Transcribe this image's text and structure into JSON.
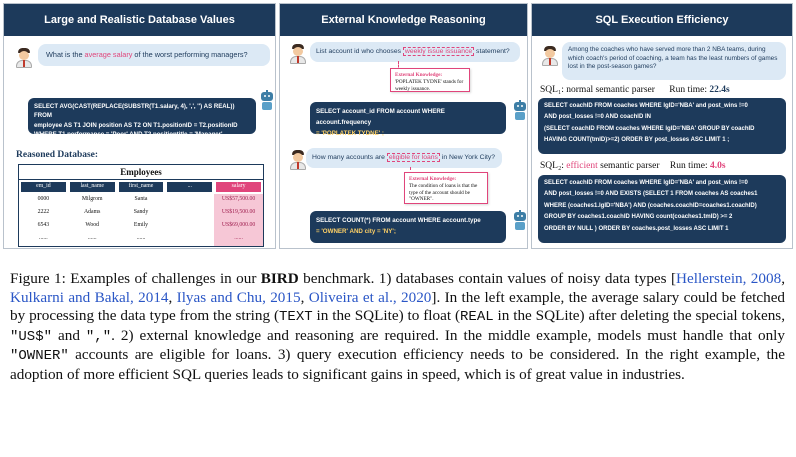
{
  "panel1": {
    "title": "Large and Realistic Database Values",
    "question_pre": "What is the ",
    "question_hl": "average salary",
    "question_post": " of the worst performing managers?",
    "sql_lines": [
      "SELECT AVG(CAST(REPLACE(SUBSTR(T1.salary, 4), ',', '') AS REAL)) FROM",
      "employee AS T1 JOIN position AS T2 ON T1.positionID = T2.positionID",
      "WHERE T1.performance = 'Poor' AND T2.positiontitle = 'Manager'"
    ],
    "db_label": "Reasoned Database:",
    "table_name": "Employees",
    "columns": [
      "em_id",
      "last_name",
      "first_name",
      "...",
      "salary"
    ],
    "rows": [
      [
        "0000",
        "Milgrom",
        "Santa",
        "",
        "US$57,500.00"
      ],
      [
        "2222",
        "Adams",
        "Sandy",
        "",
        "US$19,500.00"
      ],
      [
        "6543",
        "Wood",
        "Emily",
        "",
        "US$69,000.00"
      ],
      [
        "......",
        "......",
        "......",
        "",
        "......"
      ]
    ]
  },
  "panel2": {
    "title": "External Knowledge Reasoning",
    "q1_pre": "List account id who chooses ",
    "q1_hl": "weekly issue issuance",
    "q1_post": " statement?",
    "k1_title": "External Knowledge:",
    "k1_text": "'POPLATEK TYDNE' stands for weekly issuance.",
    "sql1_a": "SELECT account_id FROM account WHERE account.frequency",
    "sql1_b": "= 'POPLATEK TYDNE' ;",
    "q2_pre": "How many accounts are ",
    "q2_hl": "eligible for loans",
    "q2_post": " in New York City?",
    "k2_title": "External Knowledge:",
    "k2_text": "The condition of loans is that the type of the account should be \"OWNER\".",
    "sql2_a": "SELECT COUNT(*) FROM account WHERE account.type",
    "sql2_b": "= 'OWNER' AND city = 'NY';"
  },
  "panel3": {
    "title": "SQL Execution Efficiency",
    "question": "Among the coaches who have served more than 2 NBA teams, during which coach's period of coaching, a team has the least numbers of games lost in the post-season games?",
    "sql1_label": "SQL₁: normal semantic parser",
    "sql1_runtime_label": "Run time: ",
    "sql1_runtime": "22.4s",
    "sql1_lines": [
      "SELECT coachID FROM coaches WHERE lgID='NBA' and post_wins !=0",
      "AND post_losses !=0 AND coachID IN",
      "(SELECT coachID FROM coaches WHERE lgID='NBA' GROUP BY coachID",
      "HAVING COUNT(tmID)>=2) ORDER BY post_losses ASC LIMIT 1 ;"
    ],
    "sql2_label_pre": "SQL₂: ",
    "sql2_label_eff": "efficient",
    "sql2_label_post": " semantic parser",
    "sql2_runtime_label": "Run time: ",
    "sql2_runtime": "4.0s",
    "sql2_lines": [
      "SELECT coachID FROM coaches WHERE lgID='NBA' and post_wins !=0",
      "AND post_losses !=0 AND EXISTS (SELECT 1 FROM coaches AS coaches1",
      "WHERE (coaches1.lgID='NBA') AND (coaches.coachID=coaches1.coachID)",
      "GROUP BY coaches1.coachID HAVING count(coaches1.tmID) >= 2",
      "ORDER BY NULL ) ORDER BY coaches.post_losses ASC LIMIT 1"
    ]
  },
  "caption": {
    "p1": "Figure 1: Examples of challenges in our ",
    "bird": "BIRD",
    "p2": " benchmark. 1) databases contain values of noisy data types [",
    "c1": "Hellerstein, 2008",
    "sep1": ", ",
    "c2": "Kulkarni and Bakal, 2014",
    "sep2": ", ",
    "c3": "Ilyas and Chu, 2015",
    "sep3": ", ",
    "c4": "Oliveira et al., 2020",
    "p3": "]. In the left example, the average salary could be fetched by processing the data type from the string (",
    "m1": "TEXT",
    "p4": " in the SQLite) to float (",
    "m2": "REAL",
    "p5": " in the SQLite) after deleting the special tokens, ",
    "m3": "\"US$\"",
    "p6": " and ",
    "m4": "\",\"",
    "p7": ". 2) external knowledge and reasoning are required. In the middle example, models must handle that only ",
    "m5": "\"OWNER\"",
    "p8": " accounts are eligible for loans. 3) query execution efficiency needs to be considered. In the right example, the adoption of more efficient SQL queries leads to significant gains in speed, which is of great value in industries."
  }
}
